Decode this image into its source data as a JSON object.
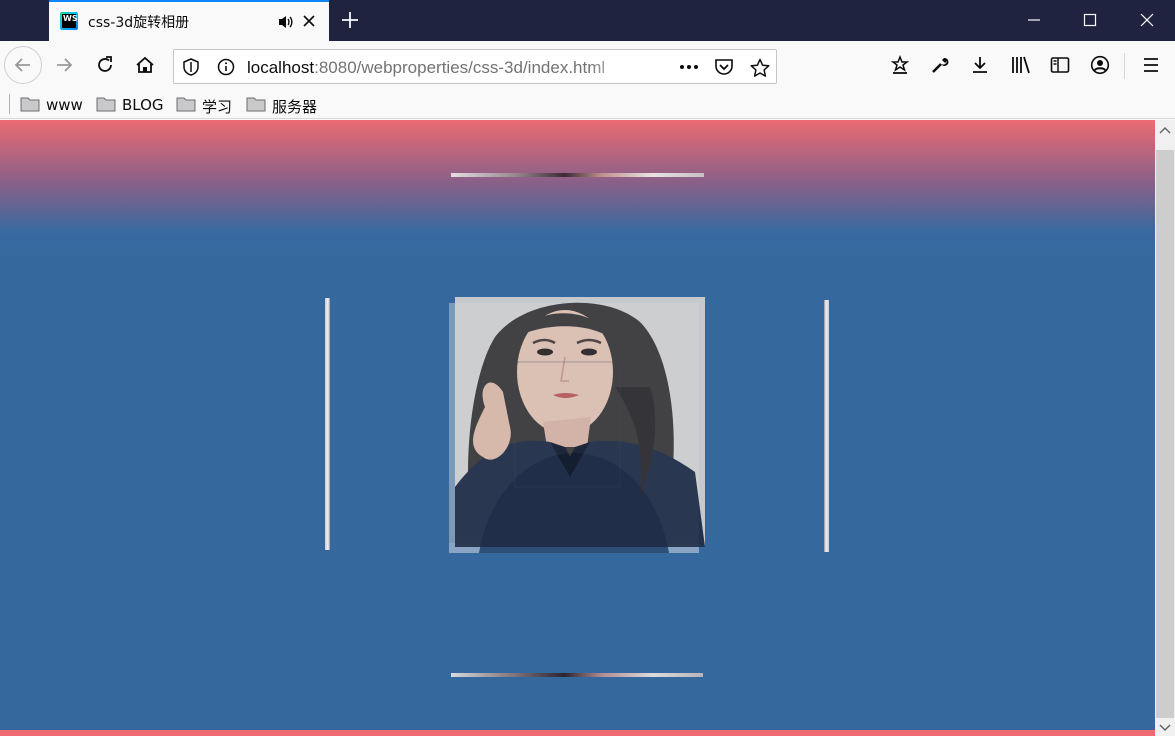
{
  "browser": {
    "tab": {
      "title": "css-3d旋转相册",
      "favicon": "webstorm-icon",
      "favicon_text": "WS",
      "audio_icon": "speaker-icon",
      "close_icon": "close-icon"
    },
    "new_tab_icon": "plus-icon",
    "window_controls": [
      "minimize-icon",
      "maximize-icon",
      "close-icon"
    ],
    "nav": {
      "back_icon": "arrow-left-icon",
      "forward_icon": "arrow-right-icon",
      "reload_icon": "reload-icon",
      "home_icon": "home-icon"
    },
    "url": {
      "host": "localhost",
      "rest": ":8080/webproperties/css-3d/index.html"
    },
    "url_icons": [
      "shield-icon",
      "info-icon",
      "more-icon",
      "pocket-icon",
      "star-icon"
    ],
    "toolbar_icons": [
      "bookmark-star-icon",
      "wrench-icon",
      "download-icon",
      "library-icon",
      "sidebar-icon",
      "account-icon",
      "menu-icon"
    ],
    "bookmarks": [
      {
        "label": "www"
      },
      {
        "label": "BLOG"
      },
      {
        "label": "学习"
      },
      {
        "label": "服务器"
      }
    ]
  },
  "page": {
    "background_top": "#eb6b73",
    "background_main": "#35699e",
    "cube_faces": [
      "front",
      "back",
      "left",
      "right",
      "top",
      "bottom"
    ]
  }
}
